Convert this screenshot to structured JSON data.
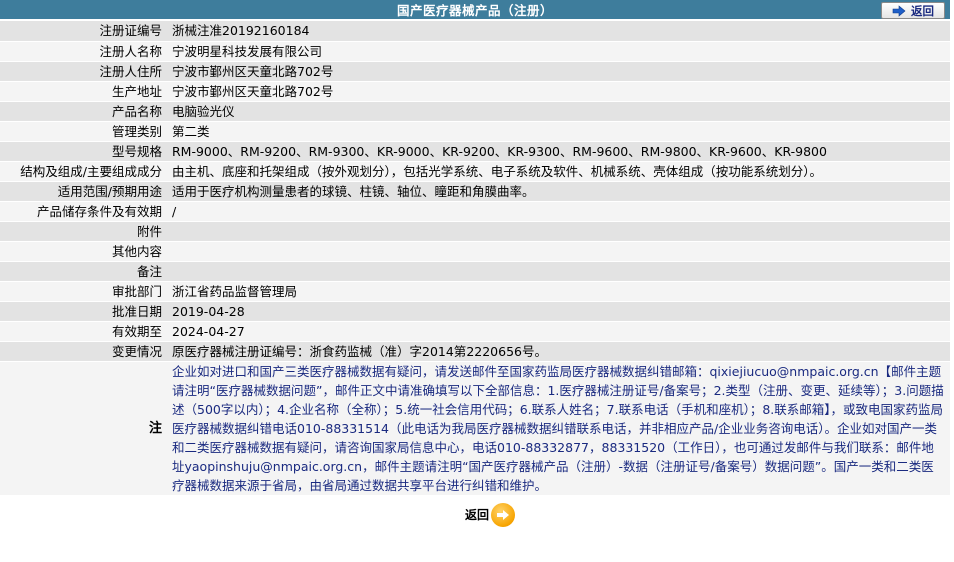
{
  "header": {
    "title": "国产医疗器械产品（注册）",
    "back_label": "返回"
  },
  "rows": [
    {
      "label": "注册证编号",
      "value": "浙械注准20192160184"
    },
    {
      "label": "注册人名称",
      "value": "宁波明星科技发展有限公司"
    },
    {
      "label": "注册人住所",
      "value": "宁波市鄞州区天童北路702号"
    },
    {
      "label": "生产地址",
      "value": "宁波市鄞州区天童北路702号"
    },
    {
      "label": "产品名称",
      "value": "电脑验光仪"
    },
    {
      "label": "管理类别",
      "value": "第二类"
    },
    {
      "label": "型号规格",
      "value": "RM-9000、RM-9200、RM-9300、KR-9000、KR-9200、KR-9300、RM-9600、RM-9800、KR-9600、KR-9800"
    },
    {
      "label": "结构及组成/主要组成成分",
      "value": "由主机、底座和托架组成（按外观划分），包括光学系统、电子系统及软件、机械系统、壳体组成（按功能系统划分）。"
    },
    {
      "label": "适用范围/预期用途",
      "value": "适用于医疗机构测量患者的球镜、柱镜、轴位、瞳距和角膜曲率。"
    },
    {
      "label": "产品储存条件及有效期",
      "value": "/"
    },
    {
      "label": "附件",
      "value": ""
    },
    {
      "label": "其他内容",
      "value": ""
    },
    {
      "label": "备注",
      "value": ""
    },
    {
      "label": "审批部门",
      "value": "浙江省药品监督管理局"
    },
    {
      "label": "批准日期",
      "value": "2019-04-28"
    },
    {
      "label": "有效期至",
      "value": "2024-04-27"
    },
    {
      "label": "变更情况",
      "value": "原医疗器械注册证编号：浙食药监械（准）字2014第2220656号。"
    }
  ],
  "note": {
    "label": "注",
    "text": "企业如对进口和国产三类医疗器械数据有疑问，请发送邮件至国家药监局医疗器械数据纠错邮箱：qixiejiucuo@nmpaic.org.cn【邮件主题请注明“医疗器械数据问题”，邮件正文中请准确填写以下全部信息：1.医疗器械注册证号/备案号；2.类型（注册、变更、延续等）；3.问题描述（500字以内）；4.企业名称（全称）；5.统一社会信用代码；6.联系人姓名；7.联系电话（手机和座机）；8.联系邮箱】，或致电国家药监局医疗器械数据纠错电话010-88331514（此电话为我局医疗器械数据纠错联系电话，并非相应产品/企业业务咨询电话）。企业如对国产一类和二类医疗器械数据有疑问，请咨询国家局信息中心，电话010-88332877，88331520（工作日），也可通过发邮件与我们联系：邮件地址yaopinshuju@nmpaic.org.cn，邮件主题请注明“国产医疗器械产品（注册）-数据（注册证号/备案号）数据问题”。国产一类和二类医疗器械数据来源于省局，由省局通过数据共享平台进行纠错和维护。"
  },
  "footer": {
    "back_label": "返回"
  },
  "colors": {
    "title_bg": "#3e7d9c",
    "row_odd": "#e3e3e3",
    "row_even": "#f4f4f4",
    "note_text": "#1a2a80"
  }
}
